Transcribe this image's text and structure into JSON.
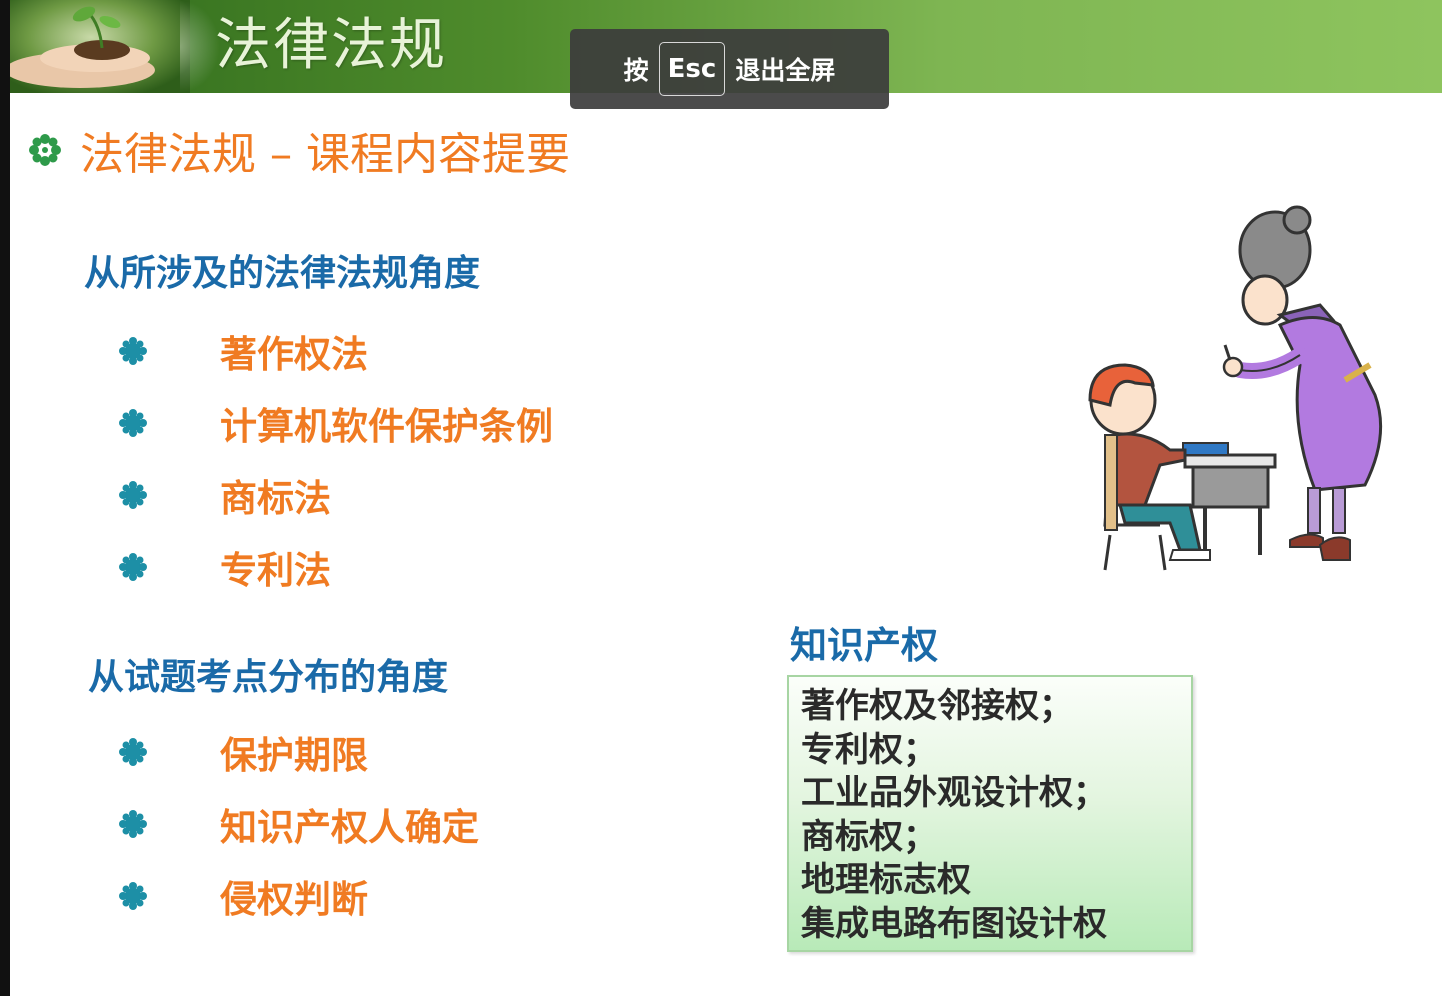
{
  "header": {
    "title": "法律法规"
  },
  "fullscreen_toast": {
    "prefix": "按",
    "key": "Esc",
    "suffix": "退出全屏"
  },
  "slide": {
    "title": "法律法规 – 课程内容提要",
    "section1": {
      "heading": "从所涉及的法律法规角度",
      "items": [
        "著作权法",
        "计算机软件保护条例",
        "商标法",
        "专利法"
      ]
    },
    "section2": {
      "heading": "从试题考点分布的角度",
      "items": [
        "保护期限",
        "知识产权人确定",
        "侵权判断"
      ]
    },
    "ip_box": {
      "title": "知识产权",
      "items": [
        "著作权及邻接权；",
        "专利权；",
        "工业品外观设计权；",
        "商标权；",
        "地理标志权",
        "集成电路布图设计权"
      ]
    }
  },
  "colors": {
    "header_green": "#4f8c2c",
    "heading_blue": "#1a6aa8",
    "item_orange": "#f07b22",
    "box_green": "#b8eab8"
  },
  "icons": {
    "title_bullet": "green-flower-icon",
    "list_bullet": "teal-star-bullet-icon"
  }
}
